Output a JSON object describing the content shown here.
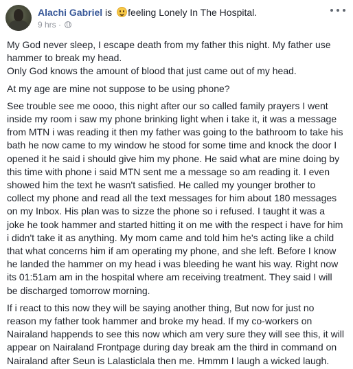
{
  "post": {
    "author": "Alachi Gabriel",
    "is_text": "is",
    "feeling": "feeling Lonely In The Hospital.",
    "time": "9 hrs",
    "separator": "·",
    "paragraphs": [
      [
        "My God never sleep, I escape death from my father this night. My father use",
        "hammer to break my head.",
        "Only God knows the amount of blood that just came out of my head."
      ],
      [
        "At my age are mine not suppose to be using phone?"
      ],
      [
        "See trouble see me oooo, this night after our so called family prayers I went",
        "inside my room i saw my phone brinking light when i take it, it was a message",
        "from MTN i was reading it then my father was going to the bathroom to take his",
        "bath he now came to my window he stood for some time and knock the door I",
        "opened it he said i should give him my phone. He said what are mine doing by",
        "this time with phone i said MTN sent me a message so am reading it. I even",
        "showed him the text he wasn't satisfied. He called my younger brother to",
        "collect my phone and read all the text messages for him about 180 messages",
        "on my Inbox. His plan was to sizze the phone so i refused. I taught it was a",
        "joke he took hammer and started hitting it on me with the respect i have for him",
        "i didn't take it as anything. My mom came and told him he's acting like a child",
        "that what concerns him if am operating my phone, and she left. Before I know",
        "he landed the hammer on my head i was bleeding he want his way. Right now",
        "its 01:51am am in the hospital where am receiving treatment. They said I will",
        "be discharged tomorrow morning."
      ],
      [
        "If i react to this now they will be saying another thing, But now for just no",
        "reason my father took hammer and broke my head. If my co-workers on",
        "Nairaland happends to see this now which am very sure they will see this, it will",
        "appear on Nairaland Frontpage during day break am the third in command on",
        "Nairaland after Seun is Lalasticlala then me. Hmmm I laugh a wicked laugh."
      ]
    ]
  },
  "icons": {
    "emoji": "smiling-emoji-icon",
    "privacy": "globe-icon",
    "menu": "more-options-icon"
  },
  "colors": {
    "author": "#385898",
    "text": "#1d2129",
    "meta": "#90949c"
  }
}
